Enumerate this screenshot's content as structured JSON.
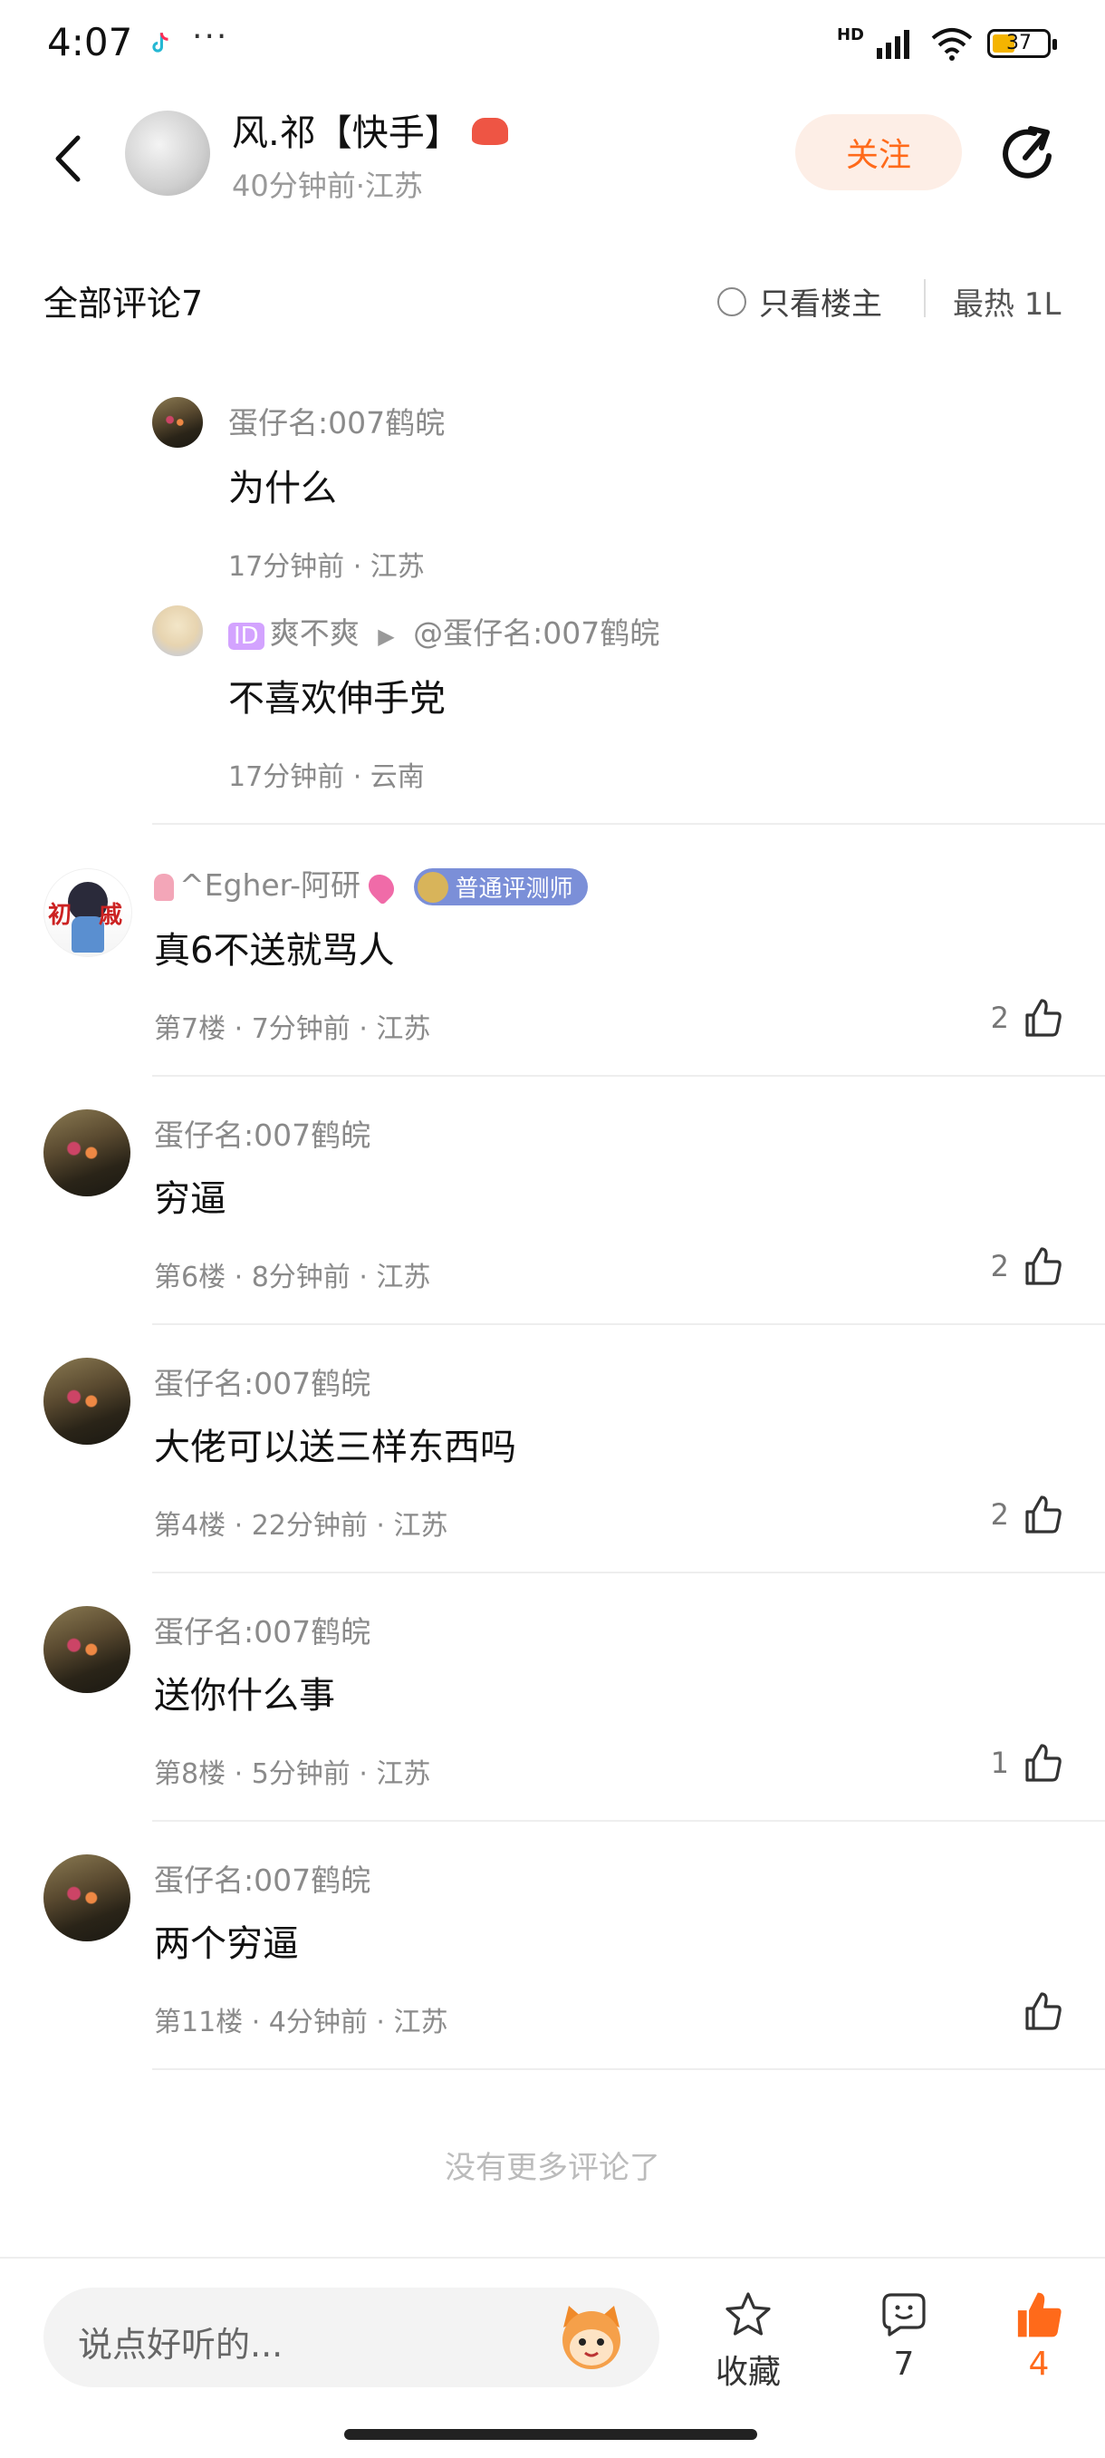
{
  "status": {
    "time": "4:07",
    "battery": "37",
    "network_label": "HD"
  },
  "header": {
    "author_name": "风.祁【快手】",
    "author_meta": "40分钟前·江苏",
    "follow_label": "关注"
  },
  "comments_bar": {
    "title": "全部评论7",
    "only_owner": "只看楼主",
    "sort_label": "最热 1L"
  },
  "replies": [
    {
      "user": "蛋仔名:007鹤皖",
      "text": "为什么",
      "meta": "17分钟前 · 江苏"
    },
    {
      "id_tag": "ID",
      "user": "爽不爽",
      "arrow": "▶",
      "target": "@蛋仔名:007鹤皖",
      "text": "不喜欢伸手党",
      "meta": "17分钟前 · 云南"
    }
  ],
  "comments": [
    {
      "user": "^Egher-阿研",
      "badge": "普通评测师",
      "text": "真6不送就骂人",
      "meta": "第7楼 · 7分钟前 · 江苏",
      "likes": "2"
    },
    {
      "user": "蛋仔名:007鹤皖",
      "text": "穷逼",
      "meta": "第6楼 · 8分钟前 · 江苏",
      "likes": "2"
    },
    {
      "user": "蛋仔名:007鹤皖",
      "text": "大佬可以送三样东西吗",
      "meta": "第4楼 · 22分钟前 · 江苏",
      "likes": "2"
    },
    {
      "user": "蛋仔名:007鹤皖",
      "text": "送你什么事",
      "meta": "第8楼 · 5分钟前 · 江苏",
      "likes": "1"
    },
    {
      "user": "蛋仔名:007鹤皖",
      "text": "两个穷逼",
      "meta": "第11楼 · 4分钟前 · 江苏",
      "likes": ""
    }
  ],
  "footer": {
    "no_more": "没有更多评论了",
    "input_placeholder": "说点好听的...",
    "favorite_label": "收藏",
    "comment_count": "7",
    "like_count": "4"
  },
  "colors": {
    "accent": "#ff6a1a",
    "follow_bg": "#fdeee6",
    "badge": "#7b8fd8"
  }
}
